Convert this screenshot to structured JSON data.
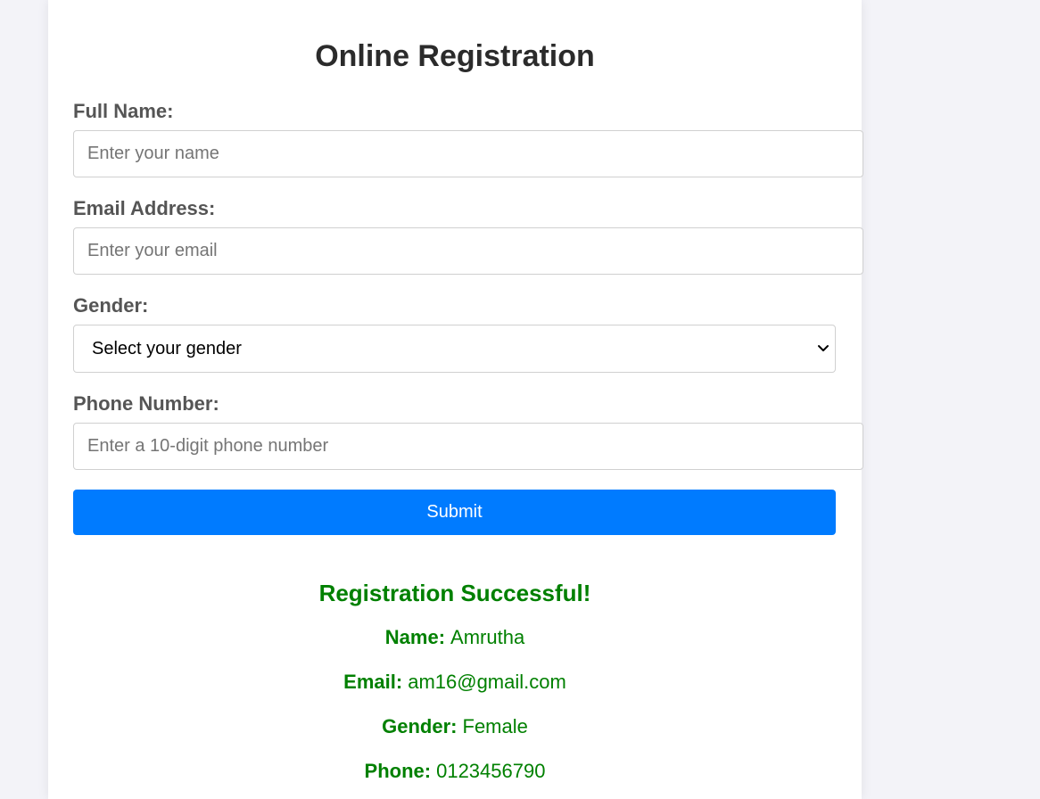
{
  "form": {
    "title": "Online Registration",
    "fields": {
      "name": {
        "label": "Full Name:",
        "value": "",
        "placeholder": "Enter your name"
      },
      "email": {
        "label": "Email Address:",
        "value": "",
        "placeholder": "Enter your email"
      },
      "gender": {
        "label": "Gender:",
        "selected": "Select your gender"
      },
      "phone": {
        "label": "Phone Number:",
        "value": "",
        "placeholder": "Enter a 10-digit phone number"
      }
    },
    "submit_label": "Submit"
  },
  "result": {
    "heading": "Registration Successful!",
    "name": {
      "key": "Name:",
      "value": "Amrutha"
    },
    "email": {
      "key": "Email:",
      "value": "am16@gmail.com"
    },
    "gender": {
      "key": "Gender:",
      "value": "Female"
    },
    "phone": {
      "key": "Phone:",
      "value": "0123456790"
    }
  },
  "colors": {
    "accent": "#007bff",
    "success": "#008000",
    "page_bg": "#f3f3f8"
  }
}
